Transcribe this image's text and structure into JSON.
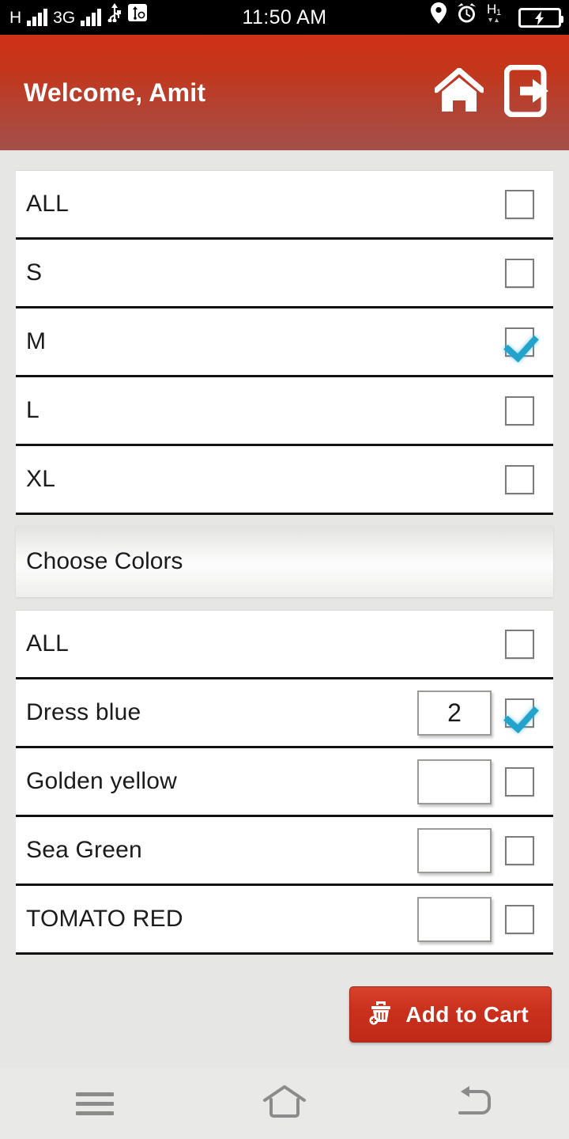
{
  "statusbar": {
    "network_letter": "H",
    "network_3g": "3G",
    "time": "11:50 AM",
    "icons_left": [
      "signal-bars-icon",
      "signal-bars-icon",
      "usb-icon",
      "usb-debug-icon"
    ],
    "icons_right": [
      "location-icon",
      "alarm-icon",
      "hspa-icon",
      "battery-charging-icon"
    ]
  },
  "header": {
    "title": "Welcome, Amit",
    "home_icon": "home-icon",
    "logout_icon": "logout-icon",
    "gradient_top": "#cf3117",
    "gradient_bottom": "#a35049"
  },
  "sizes": {
    "rows": [
      {
        "label": "ALL",
        "checked": false
      },
      {
        "label": "S",
        "checked": false
      },
      {
        "label": "M",
        "checked": true
      },
      {
        "label": "L",
        "checked": false
      },
      {
        "label": "XL",
        "checked": false
      }
    ]
  },
  "colors_section": {
    "heading": "Choose Colors",
    "rows": [
      {
        "label": "ALL",
        "qty": "",
        "has_qty": false,
        "checked": false
      },
      {
        "label": "Dress blue",
        "qty": "2",
        "has_qty": true,
        "checked": true
      },
      {
        "label": "Golden yellow",
        "qty": "",
        "has_qty": true,
        "checked": false
      },
      {
        "label": "Sea Green",
        "qty": "",
        "has_qty": true,
        "checked": false
      },
      {
        "label": "TOMATO RED",
        "qty": "",
        "has_qty": true,
        "checked": false
      }
    ]
  },
  "actions": {
    "add_to_cart_label": "Add to Cart",
    "add_to_cart_icon": "shopping-basket-add-icon",
    "accent_color": "#c9301c"
  },
  "navbar": {
    "menu_icon": "menu-icon",
    "home_icon": "home-outline-icon",
    "back_icon": "back-arrow-icon"
  }
}
